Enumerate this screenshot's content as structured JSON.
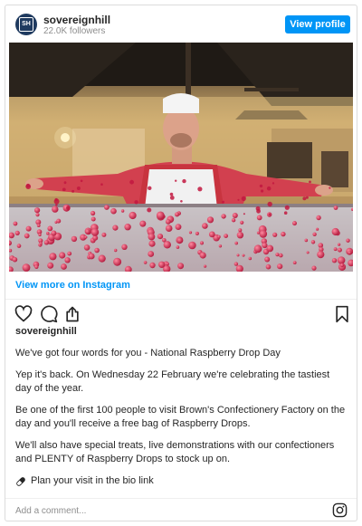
{
  "header": {
    "username": "sovereignhill",
    "followers": "22.0K followers",
    "view_profile": "View profile",
    "avatar_text": "SH"
  },
  "photo": {
    "alt": "Confectioner spreading raspberry drops on a table"
  },
  "view_more": "View more on Instagram",
  "actions": {
    "icons": [
      "heart-icon",
      "comment-icon",
      "share-icon",
      "bookmark-icon"
    ]
  },
  "post": {
    "username": "sovereignhill",
    "caption": [
      "We've got four words for you - National Raspberry Drop Day",
      "Yep it's back. On Wednesday 22 February we're celebrating the tastiest day of the year.",
      "Be one of the first 100 people to visit Brown's Confectionery Factory on the day and you'll receive a free bag of Raspberry Drops.",
      "We'll also have special treats, live demonstrations with our confectioners and PLENTY of Raspberry Drops to stock up on."
    ],
    "plan_visit": "Plan your visit in the bio link"
  },
  "comment": {
    "placeholder": "Add a comment..."
  },
  "colors": {
    "accent": "#0095f6",
    "text": "#262626",
    "muted": "#8e8e8e",
    "border": "#dbdbdb"
  }
}
